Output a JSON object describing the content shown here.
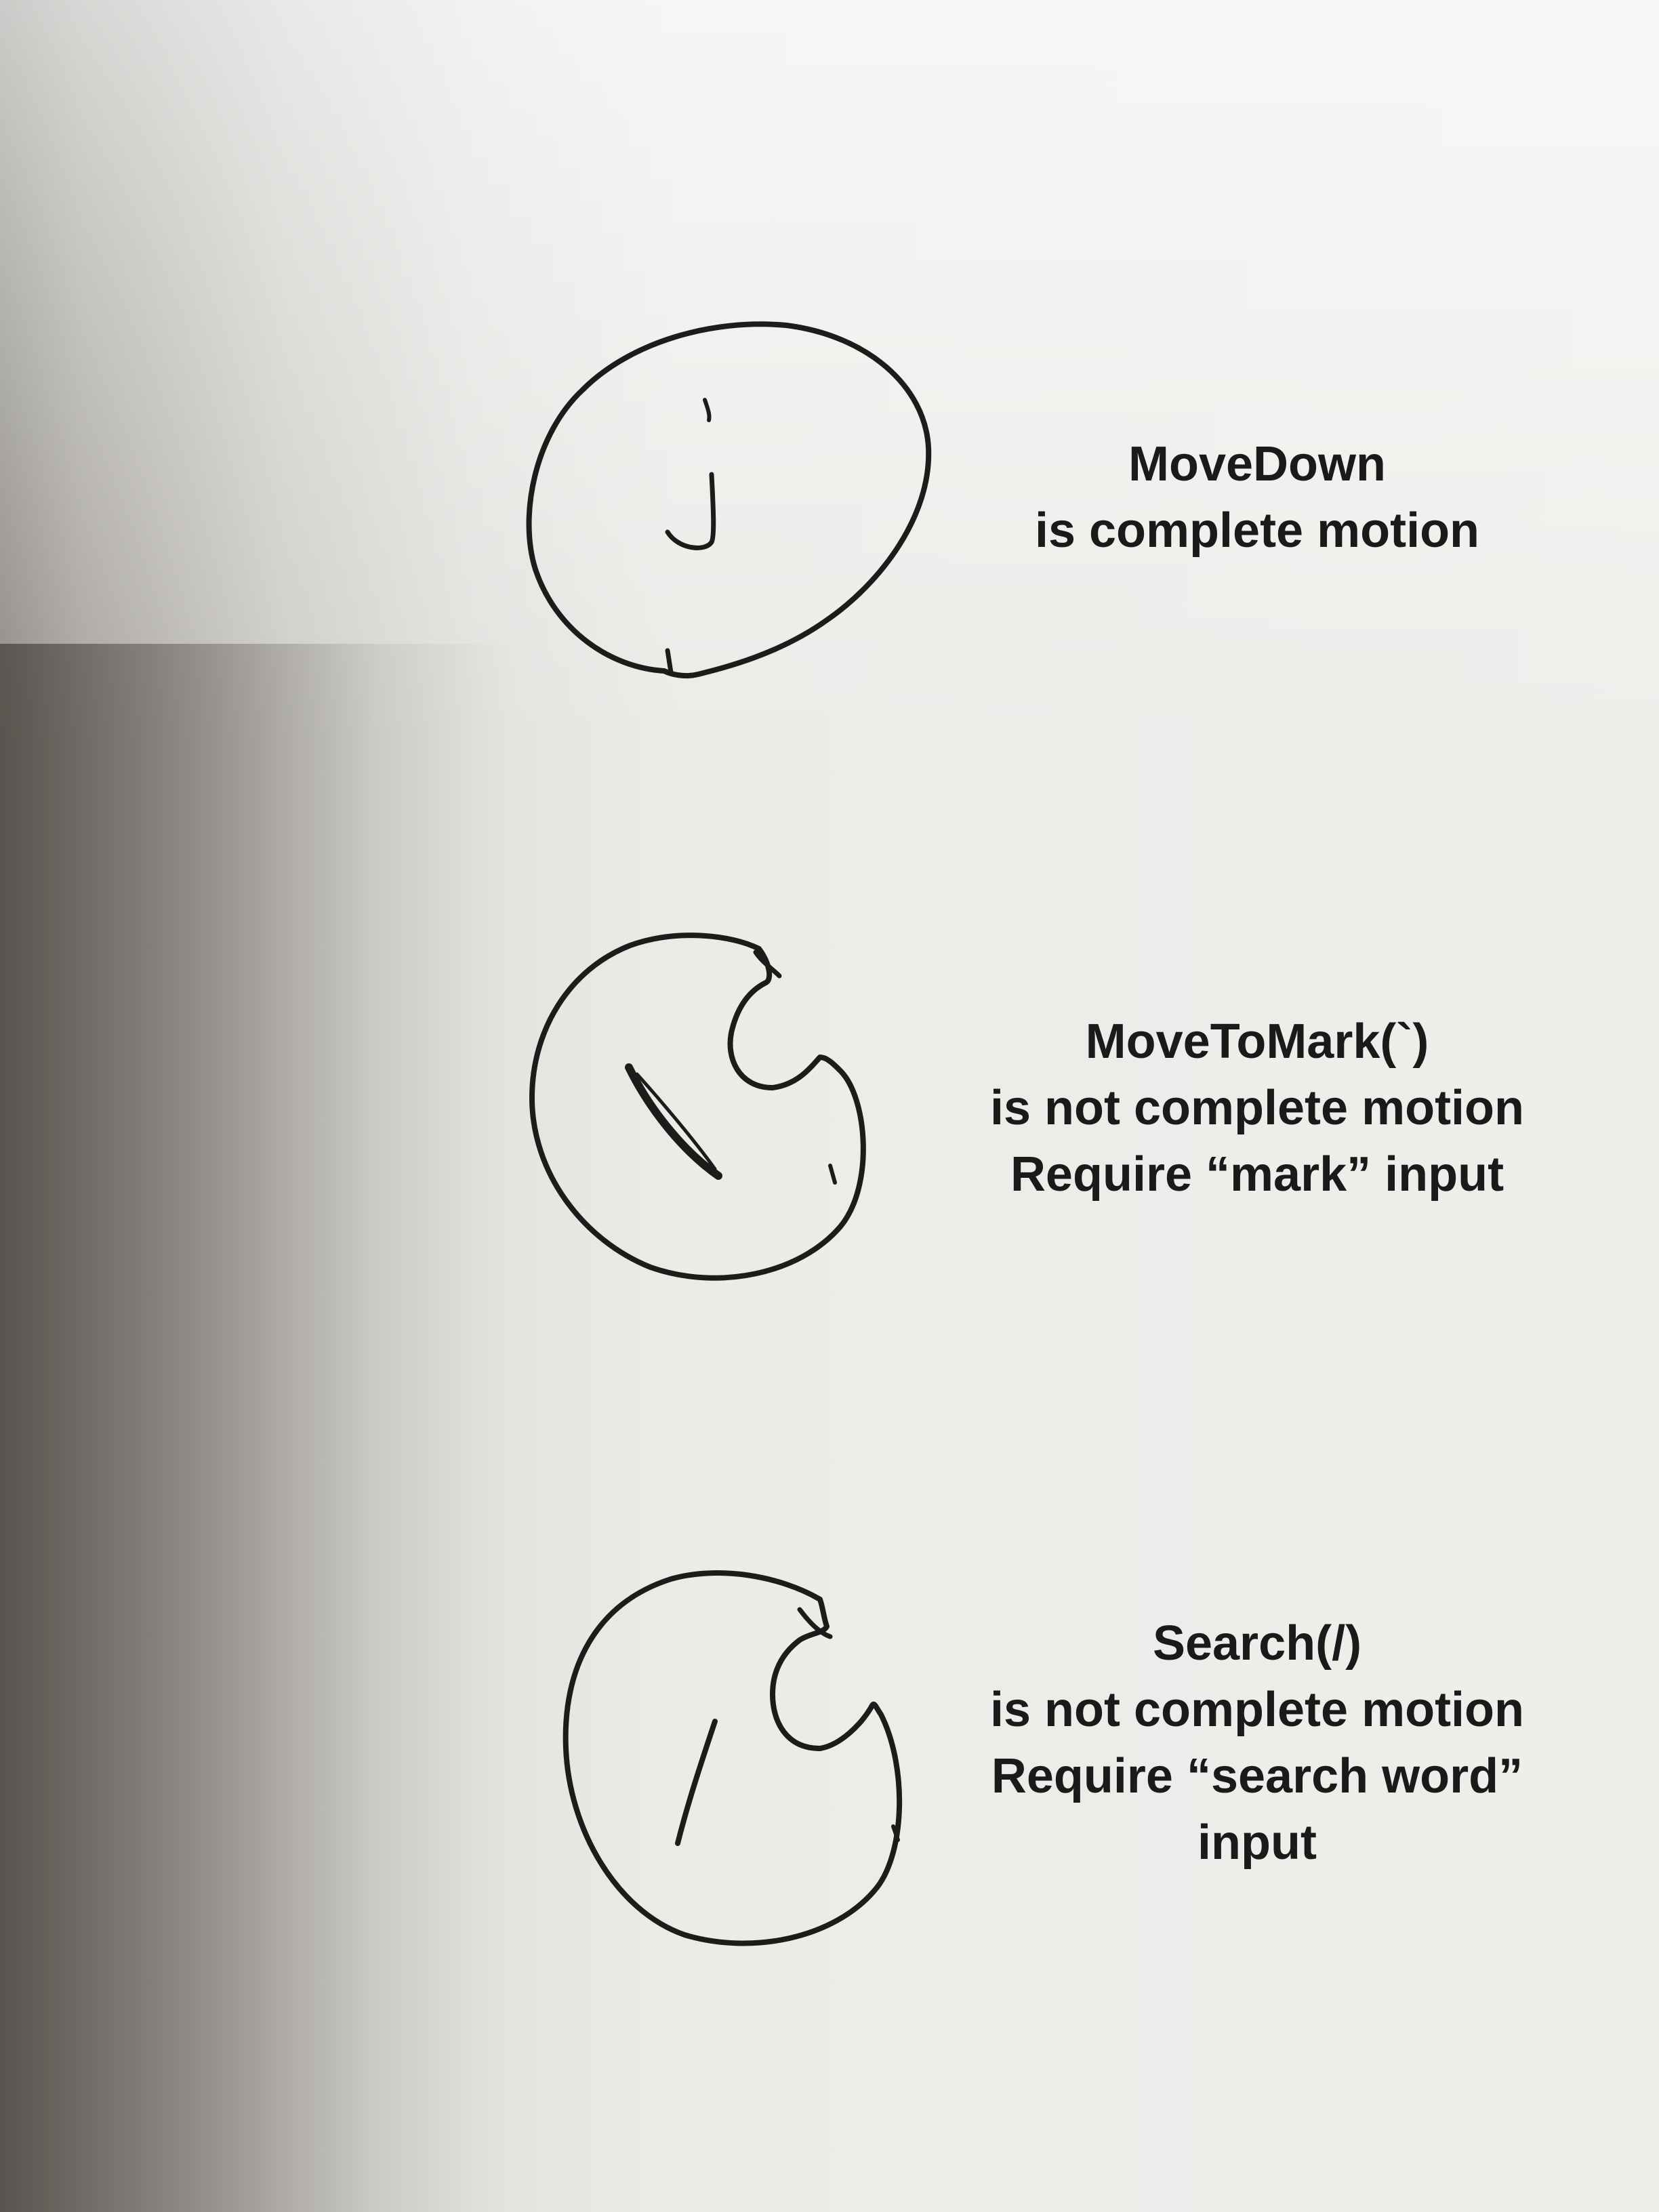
{
  "items": [
    {
      "symbol": "j",
      "lines": [
        "MoveDown",
        "is complete motion"
      ]
    },
    {
      "symbol": "`",
      "lines": [
        "MoveToMark(`)",
        "is not complete motion",
        "Require “mark” input"
      ]
    },
    {
      "symbol": "/",
      "lines": [
        "Search(/)",
        "is not complete motion",
        "Require “search word”",
        "input"
      ]
    }
  ],
  "colors": {
    "ink": "#1a1a1a",
    "paper": "#efeeeb"
  }
}
